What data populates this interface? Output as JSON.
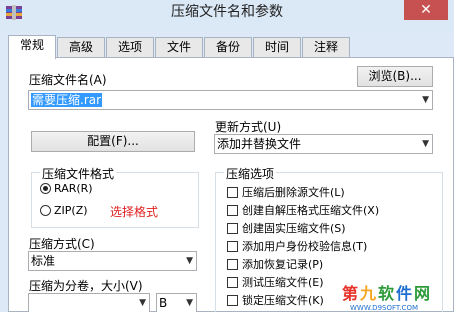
{
  "window": {
    "title": "压缩文件名和参数",
    "close_glyph": "✕"
  },
  "tabs": [
    {
      "label": "常规",
      "active": true
    },
    {
      "label": "高级"
    },
    {
      "label": "选项"
    },
    {
      "label": "文件"
    },
    {
      "label": "备份"
    },
    {
      "label": "时间"
    },
    {
      "label": "注释"
    }
  ],
  "archive_name": {
    "label": "压缩文件名(A)",
    "value": "需要压缩.rar",
    "browse_label": "浏览(B)..."
  },
  "profiles_button": "配置(F)...",
  "update_mode": {
    "label": "更新方式(U)",
    "value": "添加并替换文件"
  },
  "format": {
    "title": "压缩文件格式",
    "options": [
      {
        "label": "RAR(R)",
        "selected": true
      },
      {
        "label": "ZIP(Z)",
        "selected": false
      }
    ],
    "annotation": "选择格式"
  },
  "compression": {
    "label": "压缩方式(C)",
    "value": "标准"
  },
  "split": {
    "label": "压缩为分卷，大小(V)",
    "size_value": "",
    "unit_value": "B"
  },
  "options": {
    "title": "压缩选项",
    "items": [
      {
        "label": "压缩后删除源文件(L)",
        "checked": false
      },
      {
        "label": "创建自解压格式压缩文件(X)",
        "checked": false
      },
      {
        "label": "创建固实压缩文件(S)",
        "checked": false
      },
      {
        "label": "添加用户身份校验信息(T)",
        "checked": false
      },
      {
        "label": "添加恢复记录(P)",
        "checked": false
      },
      {
        "label": "测试压缩文件(E)",
        "checked": false
      },
      {
        "label": "锁定压缩文件(K)",
        "checked": false
      }
    ]
  },
  "watermark": {
    "top_text": "第九软件网",
    "bottom_text": "WWW.D9SOFT.COM",
    "colors": [
      "#e8332a",
      "#f5a623",
      "#2d9b3a",
      "#1f6fd1"
    ]
  },
  "icons": {
    "app": "winrar-icon",
    "dropdown": "chevron-down-icon"
  }
}
